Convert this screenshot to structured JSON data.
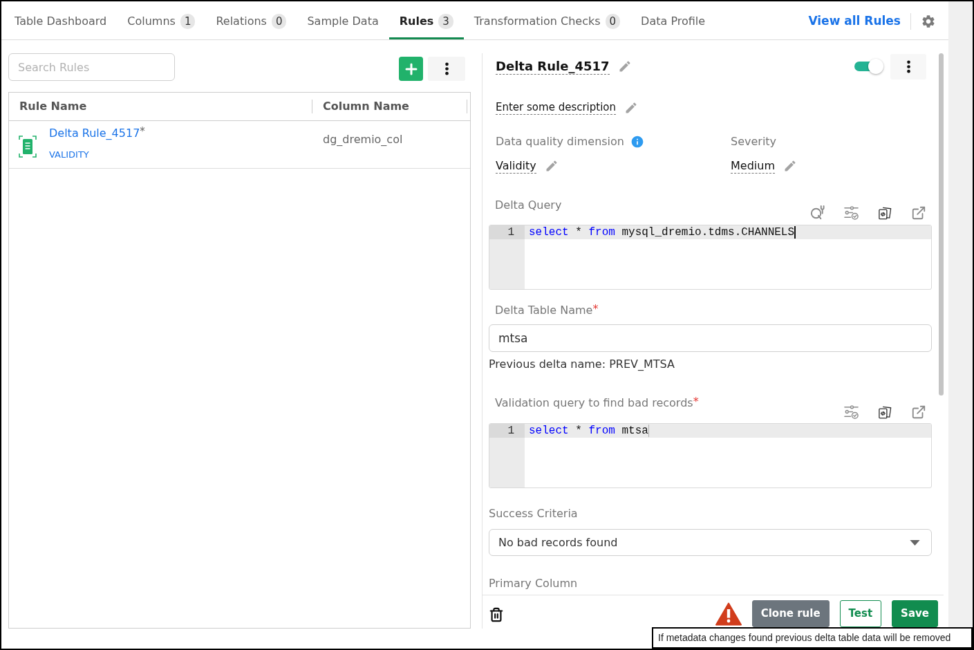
{
  "tabs": [
    {
      "label": "Table Dashboard",
      "selected": false
    },
    {
      "label": "Columns",
      "count": "1",
      "selected": false
    },
    {
      "label": "Relations",
      "count": "0",
      "selected": false
    },
    {
      "label": "Sample Data",
      "selected": false
    },
    {
      "label": "Rules",
      "count": "3",
      "selected": true
    },
    {
      "label": "Transformation Checks",
      "count": "0",
      "selected": false
    },
    {
      "label": "Data Profile",
      "selected": false
    }
  ],
  "view_all_link": "View all Rules",
  "rules_list": {
    "search": {
      "placeholder": "Search Rules"
    },
    "table": {
      "columns": [
        "Rule Name",
        "Column Name"
      ],
      "rows": [
        {
          "rule_name": "Delta Rule_4517",
          "unsaved_mark": "*",
          "dimension": "VALIDITY",
          "column_name": "dg_dremio_col"
        }
      ]
    }
  },
  "rule_editor": {
    "title": "Delta Rule_4517",
    "enabled": true,
    "description": "Enter some description",
    "dimension": {
      "label": "Data quality dimension",
      "value": "Validity"
    },
    "severity": {
      "label": "Severity",
      "value": "Medium"
    },
    "delta_query": {
      "label": "Delta Query",
      "focused": true,
      "lines": [
        {
          "number": "1",
          "tokens": [
            {
              "kind": "keyword",
              "text": "select"
            },
            {
              "kind": "plain",
              "text": " * "
            },
            {
              "kind": "keyword",
              "text": "from"
            },
            {
              "kind": "plain",
              "text": " mysql_dremio.tdms.CHANNELS"
            }
          ]
        }
      ]
    },
    "delta_table_name": {
      "label": "Delta Table Name",
      "required_mark": "*",
      "value": "mtsa",
      "hint": "Previous delta name: PREV_MTSA"
    },
    "validation_query": {
      "label": "Validation query to find bad records",
      "required_mark": "*",
      "focused": false,
      "lines": [
        {
          "number": "1",
          "tokens": [
            {
              "kind": "keyword",
              "text": "select"
            },
            {
              "kind": "plain",
              "text": " * "
            },
            {
              "kind": "keyword",
              "text": "from"
            },
            {
              "kind": "plain",
              "text": " mtsa"
            }
          ]
        }
      ]
    },
    "success_criteria": {
      "label": "Success Criteria",
      "value": "No bad records found"
    },
    "primary_column": {
      "label": "Primary Column"
    }
  },
  "footer": {
    "buttons": [
      {
        "label": "Clone rule",
        "kind": "secondary"
      },
      {
        "label": "Test",
        "kind": "outline"
      },
      {
        "label": "Save",
        "kind": "primary"
      }
    ]
  },
  "tooltip": "If metadata changes found previous delta table data will be removed"
}
